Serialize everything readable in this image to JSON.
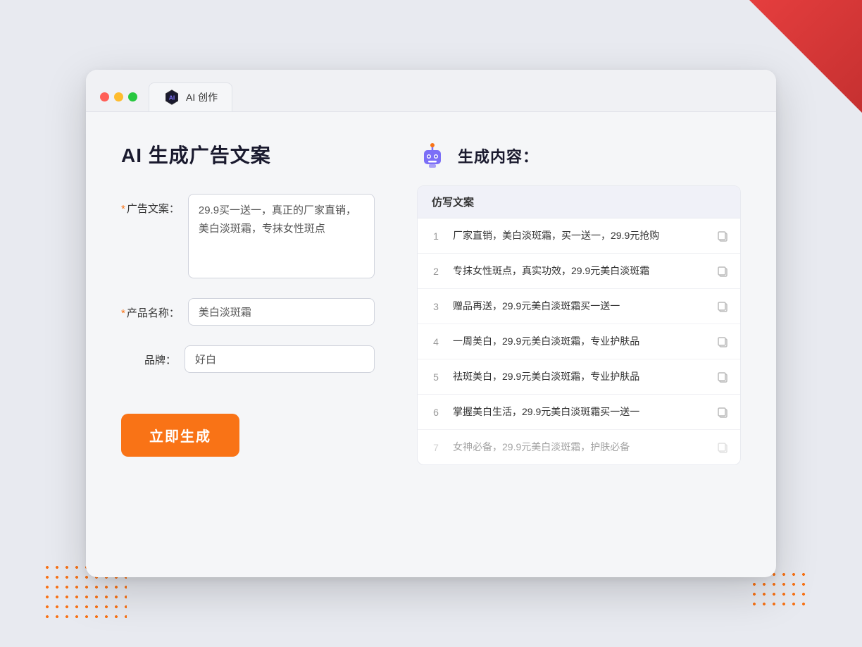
{
  "browser": {
    "tab_label": "AI 创作"
  },
  "page": {
    "title": "AI 生成广告文案",
    "right_title": "生成内容："
  },
  "form": {
    "ad_copy_label": "广告文案：",
    "ad_copy_required": "*",
    "ad_copy_value": "29.9买一送一，真正的厂家直销，美白淡斑霜，专抹女性斑点",
    "product_name_label": "产品名称：",
    "product_name_required": "*",
    "product_name_value": "美白淡斑霜",
    "brand_label": "品牌：",
    "brand_value": "好白",
    "generate_btn": "立即生成"
  },
  "results": {
    "column_header": "仿写文案",
    "items": [
      {
        "id": 1,
        "text": "厂家直销，美白淡斑霜，买一送一，29.9元抢购",
        "faded": false
      },
      {
        "id": 2,
        "text": "专抹女性斑点，真实功效，29.9元美白淡斑霜",
        "faded": false
      },
      {
        "id": 3,
        "text": "赠品再送，29.9元美白淡斑霜买一送一",
        "faded": false
      },
      {
        "id": 4,
        "text": "一周美白，29.9元美白淡斑霜，专业护肤品",
        "faded": false
      },
      {
        "id": 5,
        "text": "祛斑美白，29.9元美白淡斑霜，专业护肤品",
        "faded": false
      },
      {
        "id": 6,
        "text": "掌握美白生活，29.9元美白淡斑霜买一送一",
        "faded": false
      },
      {
        "id": 7,
        "text": "女神必备，29.9元美白淡斑霜，护肤必备",
        "faded": true
      }
    ]
  }
}
